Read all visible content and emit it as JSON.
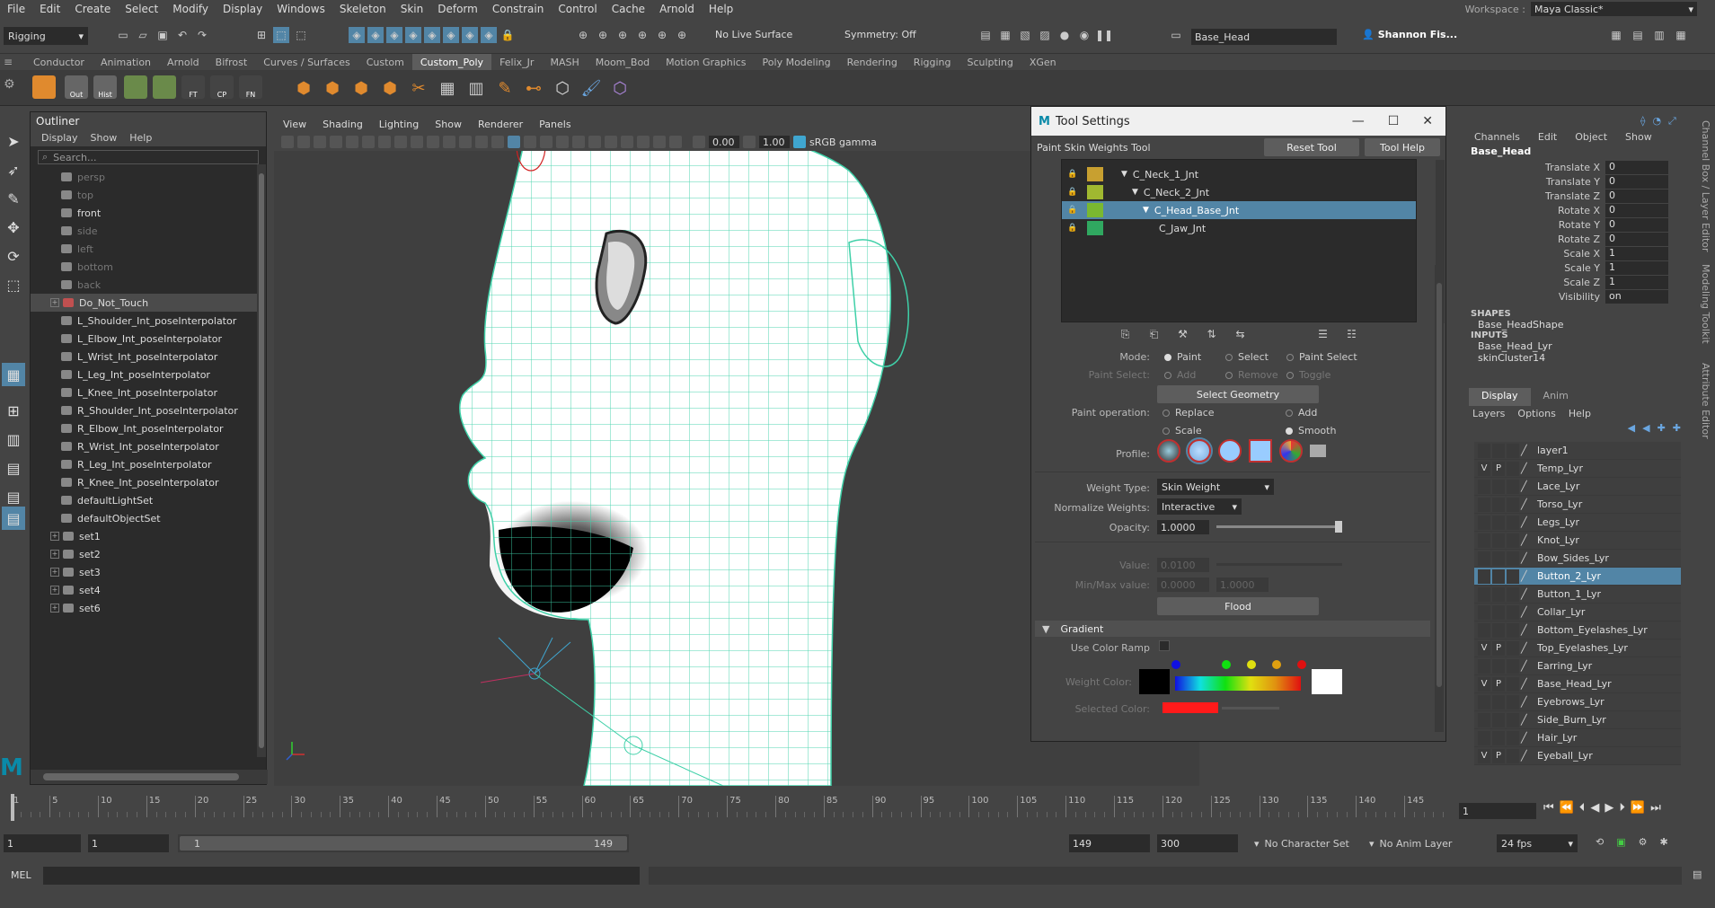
{
  "menubar": [
    "File",
    "Edit",
    "Create",
    "Select",
    "Modify",
    "Display",
    "Windows",
    "Skeleton",
    "Skin",
    "Deform",
    "Constrain",
    "Control",
    "Cache",
    "Arnold",
    "Help"
  ],
  "workspace": {
    "label": "Workspace :",
    "value": "Maya Classic*"
  },
  "status": {
    "mode": "Rigging",
    "live_surface": "No Live Surface",
    "symmetry": "Symmetry: Off",
    "object_field": "Base_Head",
    "user": "Shannon Fis..."
  },
  "shelf_tabs": [
    "Conductor",
    "Animation",
    "Arnold",
    "Bifrost",
    "Curves / Surfaces",
    "Custom",
    "Custom_Poly",
    "Felix_Jr",
    "MASH",
    "Moom_Bod",
    "Motion Graphics",
    "Poly Modeling",
    "Rendering",
    "Rigging",
    "Sculpting",
    "XGen"
  ],
  "shelf_active": "Custom_Poly",
  "shelf_icons": [
    {
      "label": "",
      "color": "#e08a2e"
    },
    {
      "label": "Out",
      "color": "#666"
    },
    {
      "label": "Hist",
      "color": "#666"
    },
    {
      "label": "",
      "color": "#6a8a4a"
    },
    {
      "label": "",
      "color": "#6a8a4a"
    },
    {
      "label": "FT",
      "color": "#444"
    },
    {
      "label": "CP",
      "color": "#444"
    },
    {
      "label": "FN",
      "color": "#444"
    }
  ],
  "outliner": {
    "title": "Outliner",
    "menus": [
      "Display",
      "Show",
      "Help"
    ],
    "search_placeholder": "Search...",
    "items": [
      {
        "label": "persp",
        "dim": true,
        "indent": 0,
        "expand": false
      },
      {
        "label": "top",
        "dim": true,
        "indent": 0,
        "expand": false
      },
      {
        "label": "front",
        "dim": false,
        "indent": 0,
        "expand": false
      },
      {
        "label": "side",
        "dim": true,
        "indent": 0,
        "expand": false
      },
      {
        "label": "left",
        "dim": true,
        "indent": 0,
        "expand": false
      },
      {
        "label": "bottom",
        "dim": true,
        "indent": 0,
        "expand": false
      },
      {
        "label": "back",
        "dim": true,
        "indent": 0,
        "expand": false
      },
      {
        "label": "Do_Not_Touch",
        "dim": false,
        "indent": 0,
        "expand": true,
        "sel": true
      },
      {
        "label": "L_Shoulder_Int_poseInterpolator",
        "indent": 0
      },
      {
        "label": "L_Elbow_Int_poseInterpolator",
        "indent": 0
      },
      {
        "label": "L_Wrist_Int_poseInterpolator",
        "indent": 0
      },
      {
        "label": "L_Leg_Int_poseInterpolator",
        "indent": 0
      },
      {
        "label": "L_Knee_Int_poseInterpolator",
        "indent": 0
      },
      {
        "label": "R_Shoulder_Int_poseInterpolator",
        "indent": 0
      },
      {
        "label": "R_Elbow_Int_poseInterpolator",
        "indent": 0
      },
      {
        "label": "R_Wrist_Int_poseInterpolator",
        "indent": 0
      },
      {
        "label": "R_Leg_Int_poseInterpolator",
        "indent": 0
      },
      {
        "label": "R_Knee_Int_poseInterpolator",
        "indent": 0
      },
      {
        "label": "defaultLightSet",
        "indent": 0
      },
      {
        "label": "defaultObjectSet",
        "indent": 0
      },
      {
        "label": "set1",
        "indent": 0,
        "expand": true
      },
      {
        "label": "set2",
        "indent": 0,
        "expand": true
      },
      {
        "label": "set3",
        "indent": 0,
        "expand": true
      },
      {
        "label": "set4",
        "indent": 0,
        "expand": true
      },
      {
        "label": "set6",
        "indent": 0,
        "expand": true
      }
    ]
  },
  "viewport": {
    "menus": [
      "View",
      "Shading",
      "Lighting",
      "Show",
      "Renderer",
      "Panels"
    ],
    "value1": "0.00",
    "value2": "1.00",
    "colorspace": "sRGB gamma"
  },
  "tool_settings": {
    "window_title": "Tool Settings",
    "tool_name": "Paint Skin Weights Tool",
    "reset_label": "Reset Tool",
    "help_label": "Tool Help",
    "joints": [
      {
        "label": "C_Neck_1_Jnt",
        "color": "#c8a030",
        "indent": 1,
        "sel": false
      },
      {
        "label": "C_Neck_2_Jnt",
        "color": "#a0b830",
        "indent": 2,
        "sel": false
      },
      {
        "label": "C_Head_Base_Jnt",
        "color": "#7ab830",
        "indent": 3,
        "sel": true
      },
      {
        "label": "C_Jaw_Jnt",
        "color": "#30a860",
        "indent": 4,
        "sel": false
      }
    ],
    "mode_label": "Mode:",
    "mode_options": [
      "Paint",
      "Select",
      "Paint Select"
    ],
    "paint_select_label": "Paint Select:",
    "paint_select_options": [
      "Add",
      "Remove",
      "Toggle"
    ],
    "select_geometry": "Select Geometry",
    "paint_op_label": "Paint operation:",
    "paint_ops": [
      "Replace",
      "Add",
      "Scale",
      "Smooth"
    ],
    "profile_label": "Profile:",
    "weight_type_label": "Weight Type:",
    "weight_type": "Skin Weight",
    "normalize_label": "Normalize Weights:",
    "normalize": "Interactive",
    "opacity_label": "Opacity:",
    "opacity": "1.0000",
    "opacity_level": 1.0,
    "value_label": "Value:",
    "value": "0.0100",
    "minmax_label": "Min/Max value:",
    "min": "0.0000",
    "max": "1.0000",
    "flood": "Flood",
    "gradient_header": "Gradient",
    "use_color_ramp": "Use Color Ramp",
    "weight_color_label": "Weight Color:",
    "selected_color_label": "Selected Color:",
    "selected_color": "#ff1a1a"
  },
  "channelbox": {
    "menus": [
      "Channels",
      "Edit",
      "Object",
      "Show"
    ],
    "object": "Base_Head",
    "channels": [
      {
        "name": "Translate X",
        "value": "0"
      },
      {
        "name": "Translate Y",
        "value": "0"
      },
      {
        "name": "Translate Z",
        "value": "0"
      },
      {
        "name": "Rotate X",
        "value": "0"
      },
      {
        "name": "Rotate Y",
        "value": "0"
      },
      {
        "name": "Rotate Z",
        "value": "0"
      },
      {
        "name": "Scale X",
        "value": "1"
      },
      {
        "name": "Scale Y",
        "value": "1"
      },
      {
        "name": "Scale Z",
        "value": "1"
      },
      {
        "name": "Visibility",
        "value": "on"
      }
    ],
    "shapes_header": "SHAPES",
    "shape": "Base_HeadShape",
    "inputs_header": "INPUTS",
    "inputs": [
      "Base_Head_Lyr",
      "skinCluster14"
    ]
  },
  "layers": {
    "tabs": [
      "Display",
      "Anim"
    ],
    "menus": [
      "Layers",
      "Options",
      "Help"
    ],
    "items": [
      {
        "name": "layer1",
        "v": "",
        "p": ""
      },
      {
        "name": "Temp_Lyr",
        "v": "V",
        "p": "P"
      },
      {
        "name": "Lace_Lyr",
        "v": "",
        "p": ""
      },
      {
        "name": "Torso_Lyr",
        "v": "",
        "p": ""
      },
      {
        "name": "Legs_Lyr",
        "v": "",
        "p": ""
      },
      {
        "name": "Knot_Lyr",
        "v": "",
        "p": ""
      },
      {
        "name": "Bow_Sides_Lyr",
        "v": "",
        "p": ""
      },
      {
        "name": "Button_2_Lyr",
        "v": "",
        "p": "",
        "sel": true
      },
      {
        "name": "Button_1_Lyr",
        "v": "",
        "p": ""
      },
      {
        "name": "Collar_Lyr",
        "v": "",
        "p": ""
      },
      {
        "name": "Bottom_Eyelashes_Lyr",
        "v": "",
        "p": ""
      },
      {
        "name": "Top_Eyelashes_Lyr",
        "v": "V",
        "p": "P"
      },
      {
        "name": "Earring_Lyr",
        "v": "",
        "p": ""
      },
      {
        "name": "Base_Head_Lyr",
        "v": "V",
        "p": "P"
      },
      {
        "name": "Eyebrows_Lyr",
        "v": "",
        "p": ""
      },
      {
        "name": "Side_Burn_Lyr",
        "v": "",
        "p": ""
      },
      {
        "name": "Hair_Lyr",
        "v": "",
        "p": ""
      },
      {
        "name": "Eyeball_Lyr",
        "v": "V",
        "p": "P"
      }
    ]
  },
  "right_strip": [
    "Channel Box / Layer Editor",
    "Modeling Toolkit",
    "Attribute Editor"
  ],
  "timeline": {
    "ticks": [
      "1",
      "5",
      "10",
      "15",
      "20",
      "25",
      "30",
      "35",
      "40",
      "45",
      "50",
      "55",
      "60",
      "65",
      "70",
      "75",
      "80",
      "85",
      "90",
      "95",
      "100",
      "105",
      "110",
      "115",
      "120",
      "125",
      "130",
      "135",
      "140",
      "145"
    ],
    "current_frame": "1"
  },
  "range": {
    "start": "1",
    "anim_start": "1",
    "range_start": "1",
    "range_end": "149",
    "range_end_field": "149",
    "anim_end": "300",
    "character_set": "No Character Set",
    "anim_layer": "No Anim Layer",
    "fps": "24 fps"
  },
  "cmdline": {
    "label": "MEL"
  }
}
